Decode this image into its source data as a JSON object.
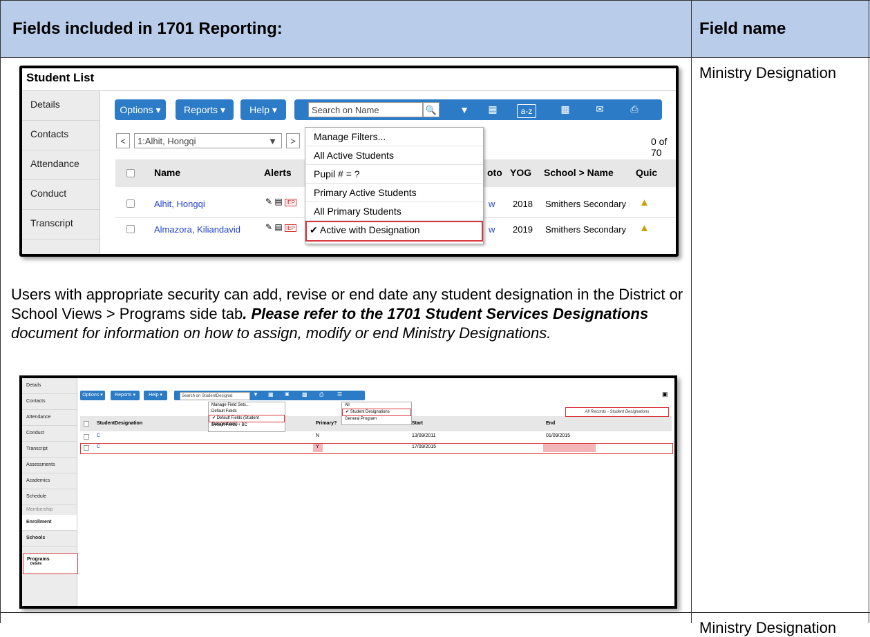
{
  "header": {
    "left": "Fields included in 1701 Reporting:",
    "right": "Field name"
  },
  "rows": [
    {
      "field_name": "Ministry Designation"
    },
    {
      "field_name": "Ministry Designation"
    }
  ],
  "paragraph": {
    "text1": "Users with appropriate security can add, revise or end date any student designation in the District or School Views > Programs side tab",
    "text2": ". Please refer to the ",
    "bold": "1701 Student Services Designations",
    "text3": " document for information on how to assign, modify or end Ministry Designations."
  },
  "shot1": {
    "title": "Student List",
    "side_tabs": [
      "Details",
      "Contacts",
      "Attendance",
      "Conduct",
      "Transcript"
    ],
    "buttons": {
      "options": "Options ▾",
      "reports": "Reports ▾",
      "help": "Help ▾"
    },
    "search_placeholder": "Search on Name",
    "toolbar_icons": [
      "search-icon",
      "filter-icon",
      "grid-icon",
      "sort-az-icon",
      "chart-icon",
      "mail-icon",
      "print-icon"
    ],
    "az_label": "a-z",
    "nav_prev": "<",
    "nav_next": ">",
    "nav_select": "1:Alhit, Hongqi",
    "record_count": "0 of 70",
    "filter_menu": [
      "Manage Filters...",
      "All Active Students",
      "Pupil # = ?",
      "Primary Active Students",
      "All Primary Students",
      "Active with Designation"
    ],
    "filter_selected_check": "✔",
    "columns": [
      "Name",
      "Alerts",
      "oto",
      "YOG",
      "School > Name",
      "Quic"
    ],
    "students": [
      {
        "name": "Alhit, Hongqi",
        "photo": "w",
        "yog": "2018",
        "school": "Smithers Secondary"
      },
      {
        "name": "Almazora, Kiliandavid",
        "photo": "w",
        "yog": "2019",
        "school": "Smithers Secondary"
      }
    ],
    "alert_badge": "IEP"
  },
  "shot2": {
    "side_tabs": [
      "Details",
      "Contacts",
      "Attendance",
      "Conduct",
      "Transcript",
      "Assessments",
      "Academics",
      "Schedule"
    ],
    "membership_label": "Membership",
    "sub_tabs": [
      "Enrollment",
      "Schools"
    ],
    "programs_label": "Programs",
    "programs_sub": "Details",
    "buttons": {
      "options": "Options ▾",
      "reports": "Reports ▾",
      "help": "Help ▾"
    },
    "search_placeholder": "Search on StudentDesignat",
    "field_sets": [
      "Manage Field Sets...",
      "Default Fields",
      "Default Fields (Student Designations)",
      "Default Fields + BC"
    ],
    "filters": [
      "All",
      "Student Designations",
      "General Program"
    ],
    "check": "✔",
    "records_label": "All Records - Student Designations",
    "columns": [
      "StudentDesignation",
      "Primary?",
      "Start",
      "End"
    ],
    "records": [
      {
        "designation": "C",
        "primary": "N",
        "start": "13/09/2011",
        "end": "01/09/2015"
      },
      {
        "designation": "C",
        "primary": "Y",
        "start": "17/09/2015",
        "end": ""
      }
    ]
  }
}
